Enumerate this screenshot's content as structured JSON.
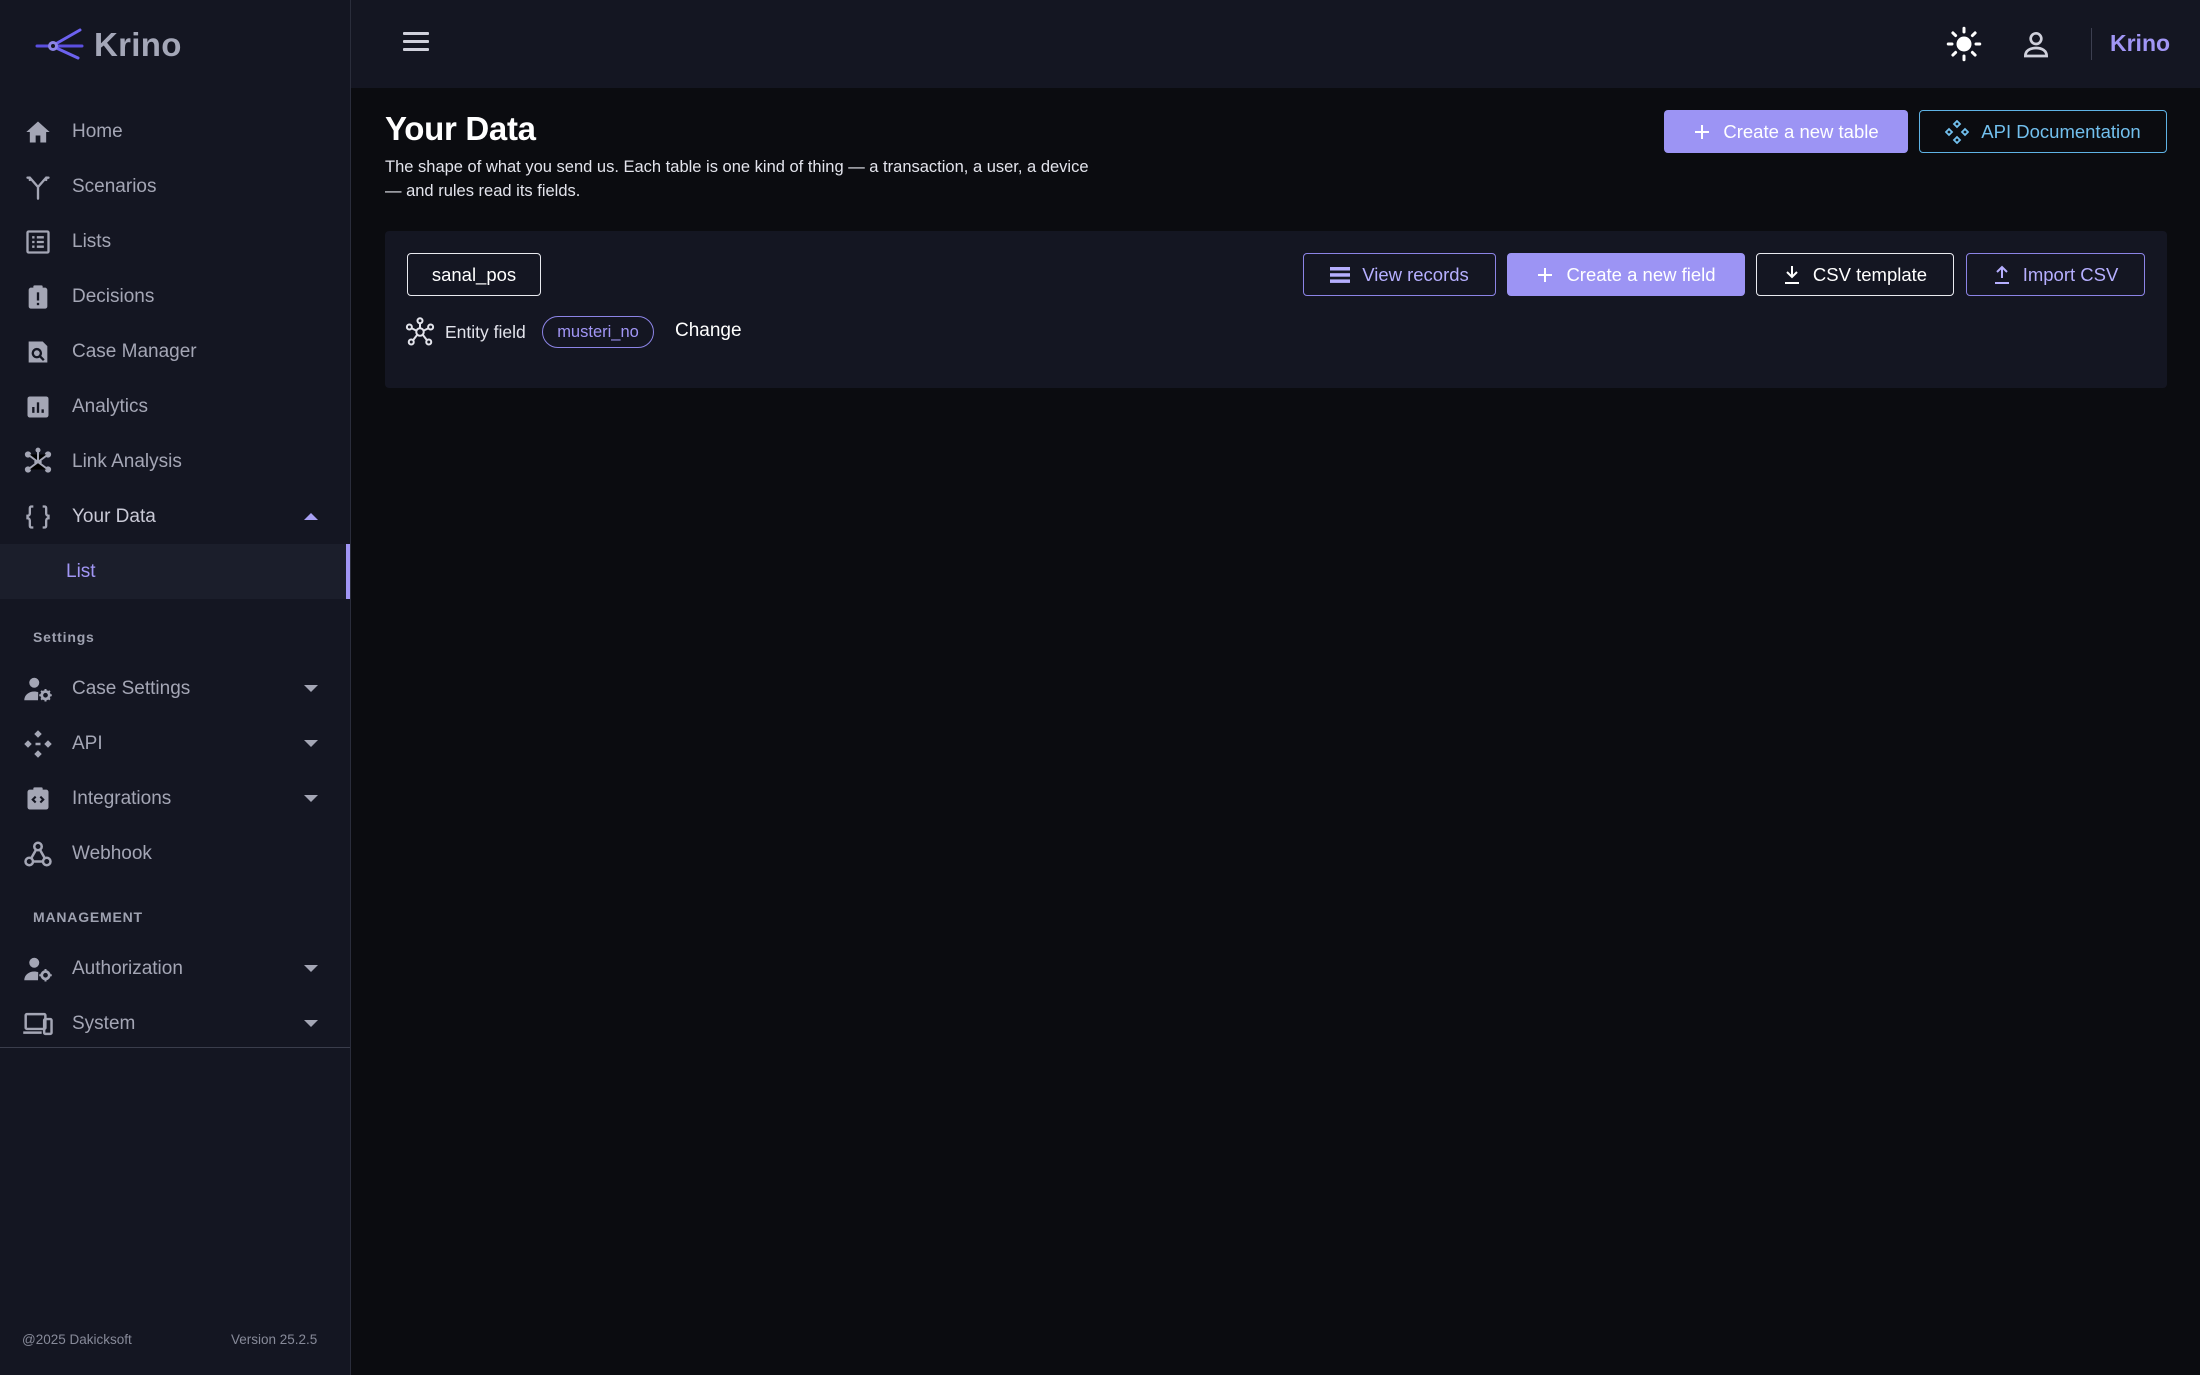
{
  "app": {
    "name": "Krino",
    "brand_right": "Krino"
  },
  "sidebar": {
    "items": [
      {
        "label": "Home",
        "icon": "home-icon"
      },
      {
        "label": "Scenarios",
        "icon": "scenarios-icon"
      },
      {
        "label": "Lists",
        "icon": "list-icon"
      },
      {
        "label": "Decisions",
        "icon": "decisions-icon"
      },
      {
        "label": "Case Manager",
        "icon": "case-manager-icon"
      },
      {
        "label": "Analytics",
        "icon": "analytics-icon"
      },
      {
        "label": "Link Analysis",
        "icon": "link-analysis-icon"
      },
      {
        "label": "Your Data",
        "icon": "data-braces-icon",
        "expanded": true
      }
    ],
    "sub_items": [
      {
        "label": "List",
        "active": true
      }
    ],
    "settings_label": "Settings",
    "settings_items": [
      {
        "label": "Case Settings",
        "icon": "case-settings-icon"
      },
      {
        "label": "API",
        "icon": "api-icon"
      },
      {
        "label": "Integrations",
        "icon": "integrations-icon"
      },
      {
        "label": "Webhook",
        "icon": "webhook-icon"
      }
    ],
    "management_label": "MANAGEMENT",
    "management_items": [
      {
        "label": "Authorization",
        "icon": "authorization-icon"
      },
      {
        "label": "System",
        "icon": "system-icon"
      }
    ],
    "footer_copyright": "@2025 Dakicksoft",
    "footer_version": "Version 25.2.5"
  },
  "header": {
    "theme_icon": "sun-icon",
    "user_icon": "user-icon",
    "menu_icon": "hamburger-icon"
  },
  "main": {
    "title": "Your Data",
    "description": "The shape of what you send us. Each table is one kind of thing — a transaction, a user, a device — and rules read its fields.",
    "create_table_label": "Create a new table",
    "api_docs_label": "API Documentation",
    "table": {
      "name": "sanal_pos",
      "view_records_label": "View records",
      "create_field_label": "Create a new field",
      "csv_template_label": "CSV template",
      "import_csv_label": "Import CSV",
      "entity_field_label": "Entity field",
      "entity_field_value": "musteri_no",
      "change_label": "Change"
    }
  },
  "colors": {
    "accent": "#9c94f4",
    "accent_text": "#a196f5",
    "link_blue": "#72c0ee",
    "background": "#0b0c10",
    "panel": "#141622"
  }
}
